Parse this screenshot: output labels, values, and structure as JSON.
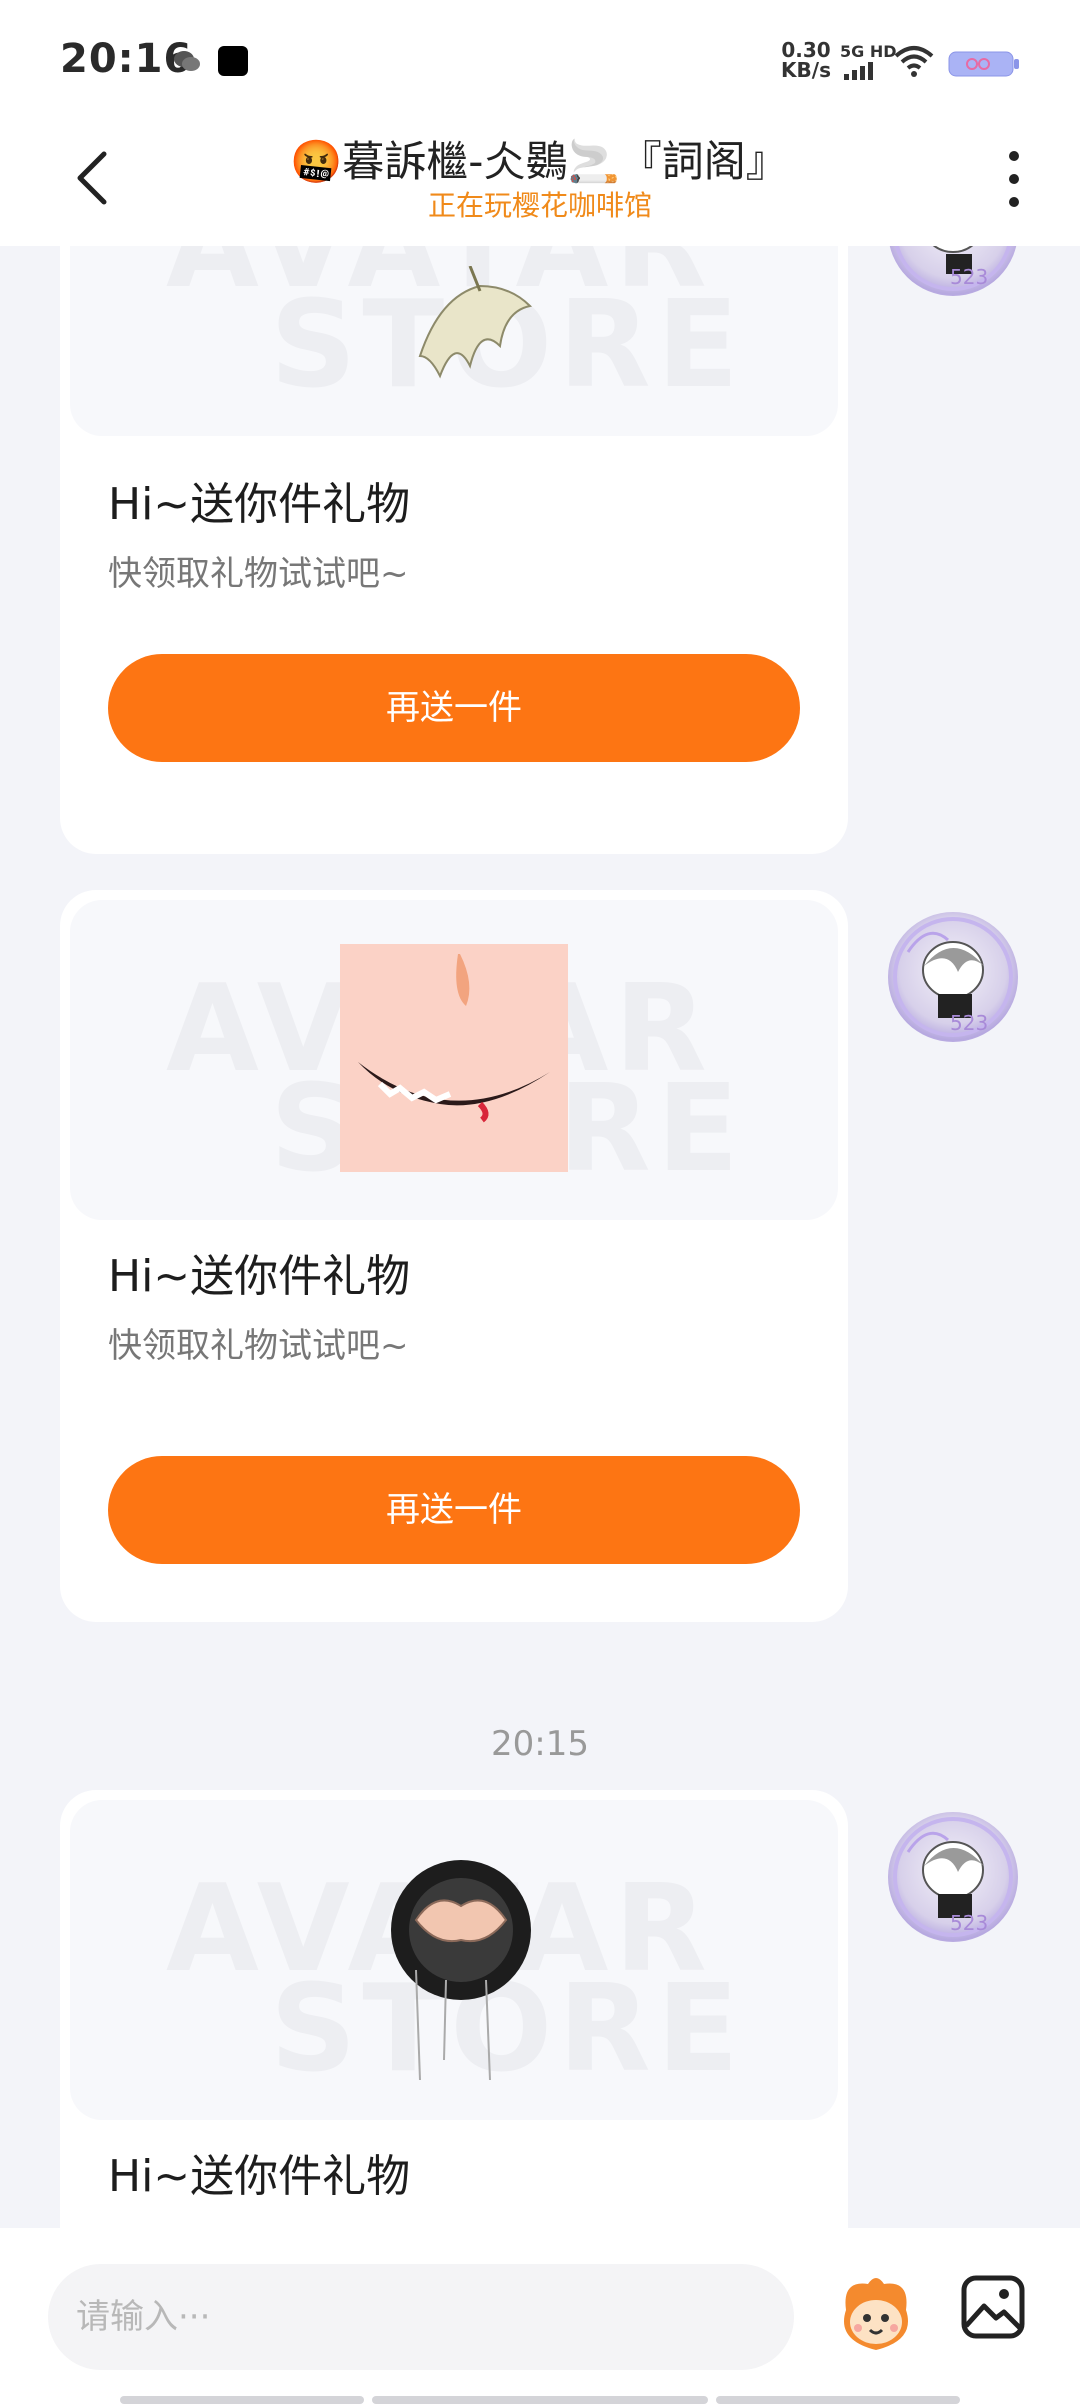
{
  "status_bar": {
    "time": "20:16",
    "net_speed_value": "0.30",
    "net_speed_unit": "KB/s",
    "net_type": "5G HD"
  },
  "header": {
    "title": "🤬暮訴檵-仌鷃🚬『詞阁』",
    "subtitle": "正在玩樱花咖啡馆"
  },
  "messages": [
    {
      "title": "Hi~送你件礼物",
      "desc": "快领取礼物试试吧~",
      "button": "再送一件",
      "watermark_line1": "AVATAR",
      "watermark_line2": "STORE"
    },
    {
      "title": "Hi~送你件礼物",
      "desc": "快领取礼物试试吧~",
      "button": "再送一件",
      "watermark_line1": "AVATAR",
      "watermark_line2": "STORE"
    },
    {
      "time": "20:15",
      "title": "Hi~送你件礼物",
      "watermark_line1": "AVATAR",
      "watermark_line2": "STORE"
    }
  ],
  "avatar_badge": "523",
  "input": {
    "placeholder": "请输入···"
  },
  "colors": {
    "accent": "#fd7513",
    "subtitle": "#f08a1a"
  }
}
